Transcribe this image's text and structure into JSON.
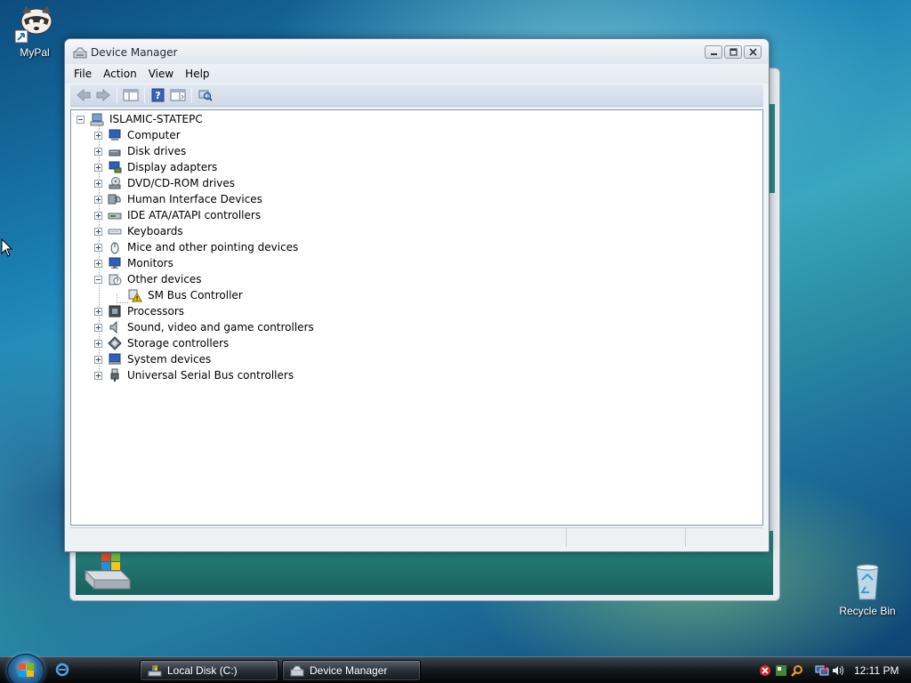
{
  "desktop": {
    "icons": [
      {
        "label": "MyPal",
        "icon": "raccoon-shortcut-icon"
      },
      {
        "label": "Recycle Bin",
        "icon": "recycle-bin-icon"
      }
    ]
  },
  "window": {
    "title": "Device Manager",
    "controls": [
      "minimize",
      "maximize",
      "close"
    ],
    "menu": [
      "File",
      "Action",
      "View",
      "Help"
    ],
    "toolbar": [
      "back-arrow-icon",
      "forward-arrow-icon",
      "show-hide-console-tree-icon",
      "help-icon",
      "properties-icon",
      "scan-hardware-icon"
    ],
    "tree": {
      "root": "ISLAMIC-STATEPC",
      "categories": [
        {
          "label": "Computer",
          "expanded": false,
          "icon": "computer-icon"
        },
        {
          "label": "Disk drives",
          "expanded": false,
          "icon": "disk-drive-icon"
        },
        {
          "label": "Display adapters",
          "expanded": false,
          "icon": "display-adapter-icon"
        },
        {
          "label": "DVD/CD-ROM drives",
          "expanded": false,
          "icon": "dvd-drive-icon"
        },
        {
          "label": "Human Interface Devices",
          "expanded": false,
          "icon": "hid-icon"
        },
        {
          "label": "IDE ATA/ATAPI controllers",
          "expanded": false,
          "icon": "ide-controller-icon"
        },
        {
          "label": "Keyboards",
          "expanded": false,
          "icon": "keyboard-icon"
        },
        {
          "label": "Mice and other pointing devices",
          "expanded": false,
          "icon": "mouse-icon"
        },
        {
          "label": "Monitors",
          "expanded": false,
          "icon": "monitor-icon"
        },
        {
          "label": "Other devices",
          "expanded": true,
          "icon": "unknown-device-icon",
          "children": [
            {
              "label": "SM Bus Controller",
              "icon": "warning-device-icon"
            }
          ]
        },
        {
          "label": "Processors",
          "expanded": false,
          "icon": "processor-icon"
        },
        {
          "label": "Sound, video and game controllers",
          "expanded": false,
          "icon": "speaker-icon"
        },
        {
          "label": "Storage controllers",
          "expanded": false,
          "icon": "storage-controller-icon"
        },
        {
          "label": "System devices",
          "expanded": false,
          "icon": "system-device-icon"
        },
        {
          "label": "Universal Serial Bus controllers",
          "expanded": false,
          "icon": "usb-icon"
        }
      ]
    }
  },
  "taskbar": {
    "tasks": [
      {
        "label": "Local Disk (C:)",
        "icon": "drive-folder-icon"
      },
      {
        "label": "Device Manager",
        "icon": "device-manager-icon"
      }
    ],
    "tray_icons": [
      "security-alert-icon",
      "app-tray-icon",
      "search-tray-icon",
      "network-icon",
      "volume-icon"
    ],
    "clock": "12:11 PM"
  },
  "colors": {
    "accent": "#1c83b6",
    "selection": "#3399ff",
    "warning": "#f5c000"
  }
}
